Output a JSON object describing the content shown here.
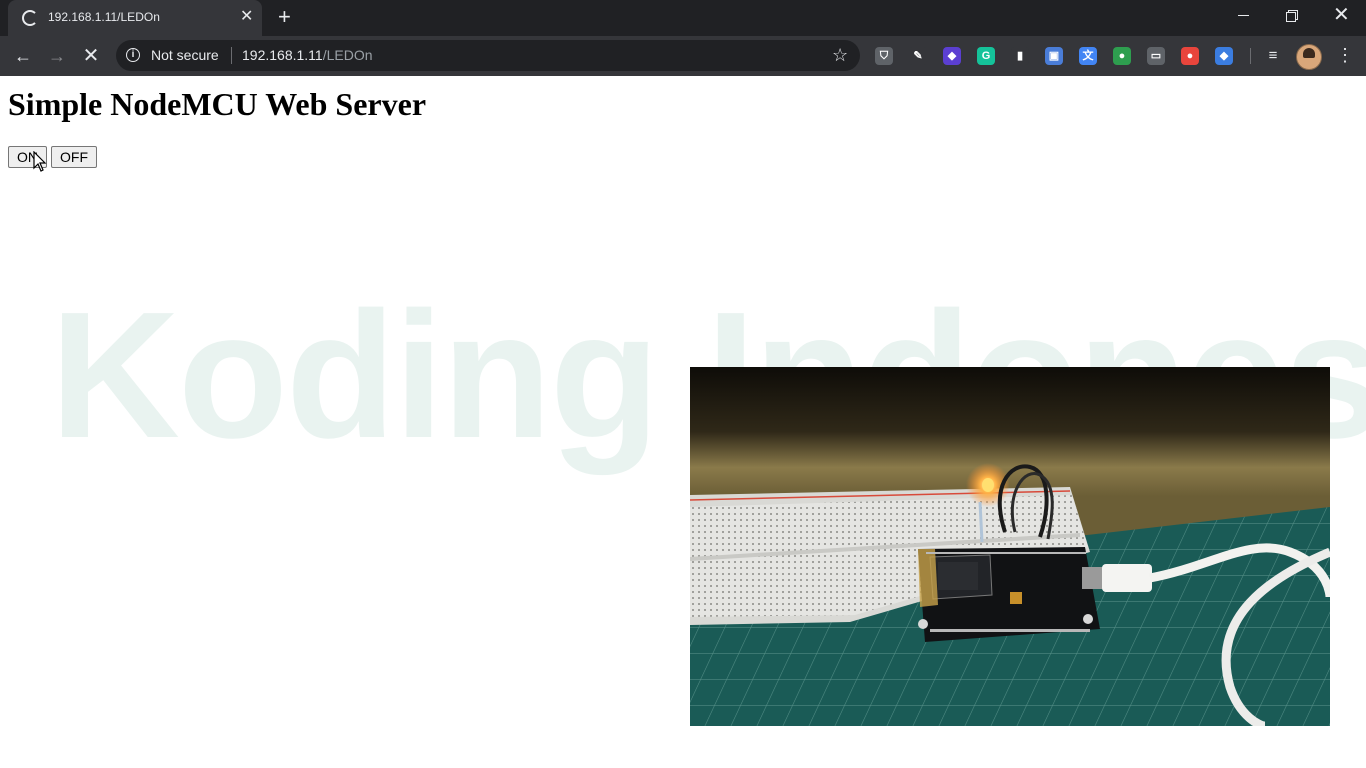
{
  "browser": {
    "tab_title": "192.168.1.11/LEDOn",
    "security_label": "Not secure",
    "url_host": "192.168.1.11",
    "url_path": "/LEDOn",
    "extensions": [
      {
        "name": "shield-extension",
        "color": "#5f6368",
        "glyph": "⛉"
      },
      {
        "name": "pen-extension",
        "color": "#35363a",
        "glyph": "✎"
      },
      {
        "name": "cube-extension",
        "color": "#5b3fd1",
        "glyph": "◆"
      },
      {
        "name": "grammarly-extension",
        "color": "#15c39a",
        "glyph": "G"
      },
      {
        "name": "chart-extension",
        "color": "#35363a",
        "glyph": "▮"
      },
      {
        "name": "screen-extension",
        "color": "#4a7dd8",
        "glyph": "▣"
      },
      {
        "name": "translate-extension",
        "color": "#4285f4",
        "glyph": "文"
      },
      {
        "name": "palette-extension",
        "color": "#2e9e4f",
        "glyph": "●"
      },
      {
        "name": "cast-extension",
        "color": "#5f6368",
        "glyph": "▭"
      },
      {
        "name": "record-extension",
        "color": "#e8453c",
        "glyph": "●"
      },
      {
        "name": "diamond-extension",
        "color": "#3b7de0",
        "glyph": "◆"
      }
    ]
  },
  "page": {
    "heading": "Simple NodeMCU Web Server",
    "on_button": "ON",
    "off_button": "OFF",
    "watermark": "Koding Indonesia"
  },
  "colors": {
    "chrome_dark": "#202124",
    "chrome_toolbar": "#35363a",
    "watermark": "#e9f3f0",
    "mat_green": "#1f6b66"
  }
}
